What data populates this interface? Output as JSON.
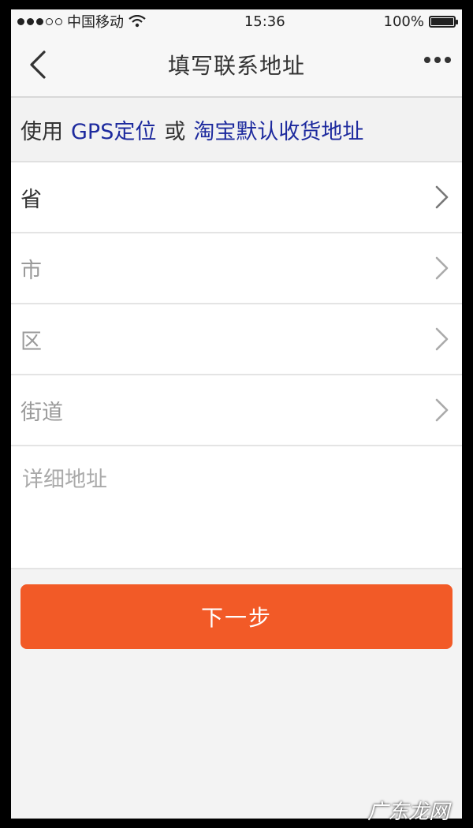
{
  "status_bar": {
    "carrier": "中国移动",
    "time": "15:36",
    "battery": "100%",
    "battery_level": 1.0
  },
  "nav": {
    "title": "填写联系地址",
    "back_icon": "chevron-left-icon",
    "more_icon": "more-horizontal-icon"
  },
  "quick_fill": {
    "prefix": "使用",
    "gps_link": "GPS定位",
    "or": "或",
    "taobao_link": "淘宝默认收货地址"
  },
  "address_rows": [
    {
      "label": "省"
    },
    {
      "label": "市"
    },
    {
      "label": "区"
    },
    {
      "label": "街道"
    }
  ],
  "detail_placeholder": "详细地址",
  "next_button": "下一步",
  "watermark": "广东龙网",
  "colors": {
    "accent": "#f25a27",
    "link": "#1d2a9e"
  }
}
